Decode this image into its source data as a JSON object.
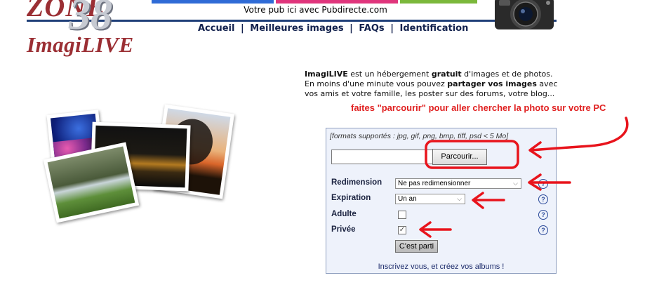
{
  "header": {
    "logo_top": "ZONE",
    "logo_number": "38",
    "logo_name": "ImagiLIVE",
    "ad_text": "Votre pub ici avec Pubdirecte.com",
    "nav": [
      "Accueil",
      "Meilleures images",
      "FAQs",
      "Identification"
    ],
    "nav_sep": "|"
  },
  "intro": {
    "brand": "ImagiLIVE",
    "t1": " est un hébergement ",
    "b1": "gratuit",
    "t2": " d'images et de photos. En moins d'une minute vous pouvez ",
    "b2": "partager vos images",
    "t3": " avec vos amis et votre famille, les poster sur des forums, votre blog..."
  },
  "annotation": "faites \"parcourir\" pour aller chercher la photo sur votre PC",
  "form": {
    "formats": "[formats supportés : jpg, gif, png, bmp, tiff, psd < 5 Mo]",
    "browse_label": "Parcourir...",
    "file_value": "",
    "resize_label": "Redimension",
    "resize_value": "Ne pas redimensionner",
    "expiration_label": "Expiration",
    "expiration_value": "Un an",
    "adult_label": "Adulte",
    "adult_checked": false,
    "private_label": "Privée",
    "private_checked": true,
    "help": "?",
    "submit_label": "C'est parti",
    "signup_text": "Inscrivez vous, et créez vos albums !"
  },
  "colors": {
    "accent_red": "#9b2f34",
    "annotation_red": "#e02020",
    "nav_blue": "#12214d",
    "form_bg": "#eef2fb"
  }
}
